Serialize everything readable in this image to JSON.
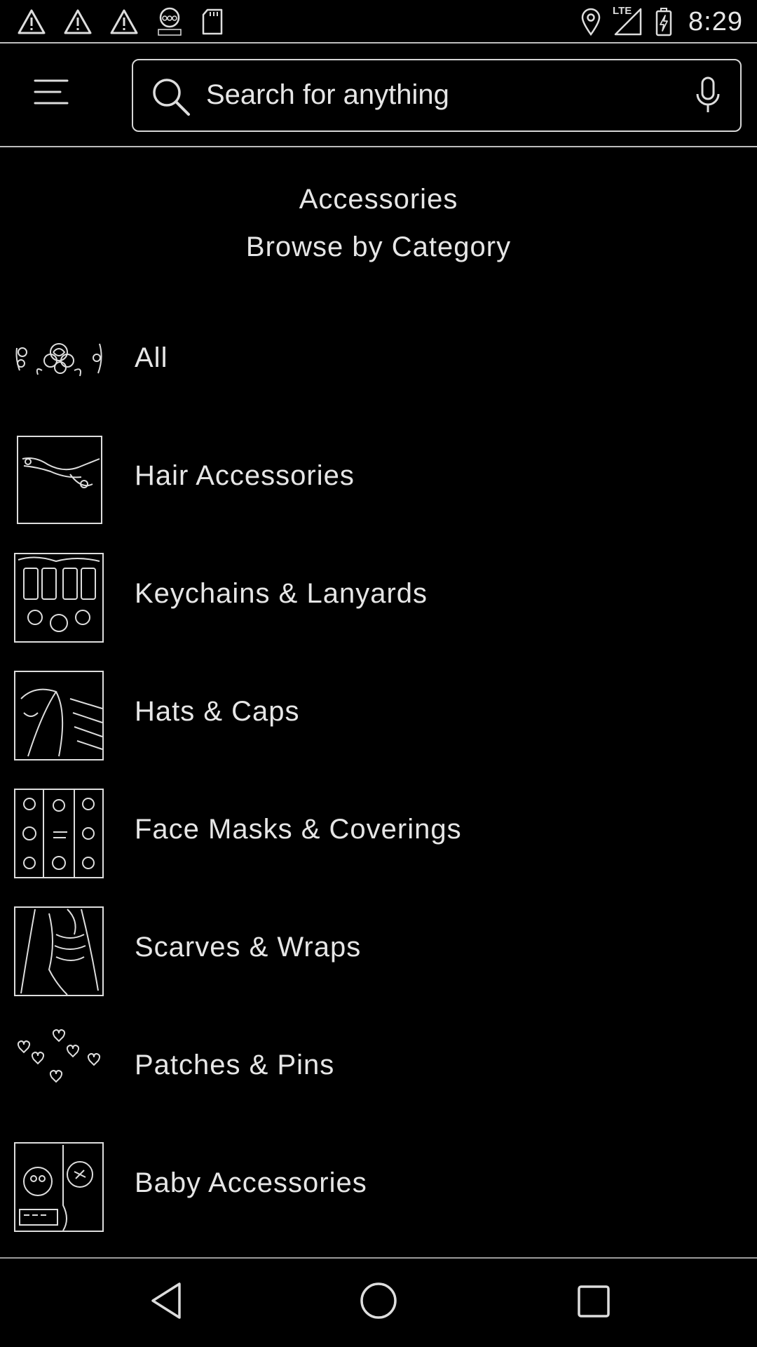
{
  "status_bar": {
    "time": "8:29",
    "network": "LTE",
    "left_icons": [
      "alert-icon",
      "alert-icon",
      "alert-icon",
      "abc-news-icon",
      "sd-card-icon"
    ],
    "right_icons": [
      "location-icon",
      "signal-icon",
      "battery-charging-icon"
    ]
  },
  "app_bar": {
    "menu_icon": "hamburger-menu-icon",
    "search": {
      "placeholder": "Search for anything",
      "value": ""
    },
    "mic_icon": "mic-icon"
  },
  "page": {
    "title": "Accessories",
    "subtitle": "Browse by Category"
  },
  "categories": [
    {
      "label": "All",
      "thumb": "roses"
    },
    {
      "label": "Hair Accessories",
      "thumb": "hair-clip"
    },
    {
      "label": "Keychains & Lanyards",
      "thumb": "keychains"
    },
    {
      "label": "Hats & Caps",
      "thumb": "hat"
    },
    {
      "label": "Face Masks & Coverings",
      "thumb": "masks"
    },
    {
      "label": "Scarves & Wraps",
      "thumb": "scarf"
    },
    {
      "label": "Patches & Pins",
      "thumb": "hearts"
    },
    {
      "label": "Baby Accessories",
      "thumb": "baby"
    }
  ],
  "nav_bar": {
    "back": "back-icon",
    "home": "home-icon",
    "recents": "recents-icon"
  },
  "colors": {
    "background": "#000000",
    "foreground": "#e6e6e6",
    "divider": "#bdbdbd"
  }
}
